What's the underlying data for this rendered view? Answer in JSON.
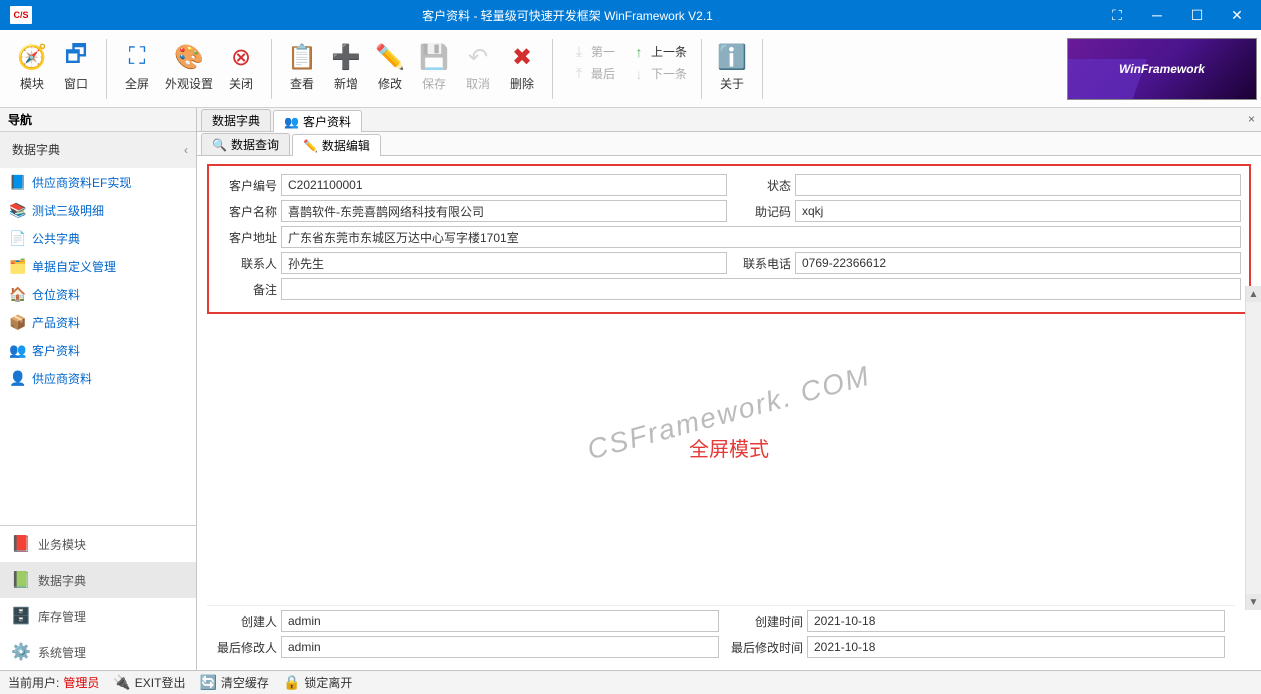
{
  "window": {
    "title": "客户资料 - 轻量级可快速开发框架 WinFramework V2.1",
    "app_icon_text": "C/S"
  },
  "ribbon": {
    "module": "模块",
    "window_btn": "窗口",
    "fullscreen": "全屏",
    "appearance": "外观设置",
    "close": "关闭",
    "view": "查看",
    "add": "新增",
    "edit": "修改",
    "save": "保存",
    "cancel": "取消",
    "delete": "删除",
    "first": "第一",
    "prev": "上一条",
    "last": "最后",
    "next": "下一条",
    "about": "关于",
    "logo": "WinFramework"
  },
  "nav": {
    "header": "导航",
    "section_title": "数据字典",
    "items": [
      {
        "label": "供应商资料EF实现",
        "icon": "📘",
        "color": "#3f8dd6"
      },
      {
        "label": "测试三级明细",
        "icon": "📚",
        "color": "#2196f3"
      },
      {
        "label": "公共字典",
        "icon": "📄",
        "color": "#9c27b0"
      },
      {
        "label": "单据自定义管理",
        "icon": "🗂️",
        "color": "#4caf50"
      },
      {
        "label": "仓位资料",
        "icon": "🏠",
        "color": "#ff9800"
      },
      {
        "label": "产品资料",
        "icon": "📦",
        "color": "#00bcd4"
      },
      {
        "label": "客户资料",
        "icon": "👥",
        "color": "#1976d2"
      },
      {
        "label": "供应商资料",
        "icon": "👤",
        "color": "#4caf50"
      }
    ],
    "groups": [
      {
        "label": "业务模块",
        "icon": "📕"
      },
      {
        "label": "数据字典",
        "icon": "📗"
      },
      {
        "label": "库存管理",
        "icon": "🗄️"
      },
      {
        "label": "系统管理",
        "icon": "⚙️"
      }
    ]
  },
  "tabs": {
    "doc": [
      {
        "label": "数据字典",
        "active": false
      },
      {
        "label": "客户资料",
        "active": true,
        "icon": "👥"
      }
    ],
    "sub": [
      {
        "label": "数据查询",
        "active": false,
        "icon": "🔍"
      },
      {
        "label": "数据编辑",
        "active": true,
        "icon": "✏️"
      }
    ]
  },
  "form": {
    "customer_id_label": "客户编号",
    "customer_id": "C2021100001",
    "status_label": "状态",
    "status": "",
    "customer_name_label": "客户名称",
    "customer_name": "喜鹊软件-东莞喜鹊网络科技有限公司",
    "mnemonic_label": "助记码",
    "mnemonic": "xqkj",
    "address_label": "客户地址",
    "address": "广东省东莞市东城区万达中心写字楼1701室",
    "contact_label": "联系人",
    "contact": "孙先生",
    "phone_label": "联系电话",
    "phone": "0769-22366612",
    "remark_label": "备注",
    "remark": "",
    "creator_label": "创建人",
    "creator": "admin",
    "create_time_label": "创建时间",
    "create_time": "2021-10-18",
    "modifier_label": "最后修改人",
    "modifier": "admin",
    "modify_time_label": "最后修改时间",
    "modify_time": "2021-10-18"
  },
  "watermark": "CSFramework. COM",
  "overlay": "全屏模式",
  "status": {
    "current_user_label": "当前用户:",
    "current_user": "管理员",
    "exit": "EXIT登出",
    "clear_cache": "清空缓存",
    "lock": "锁定离开"
  }
}
